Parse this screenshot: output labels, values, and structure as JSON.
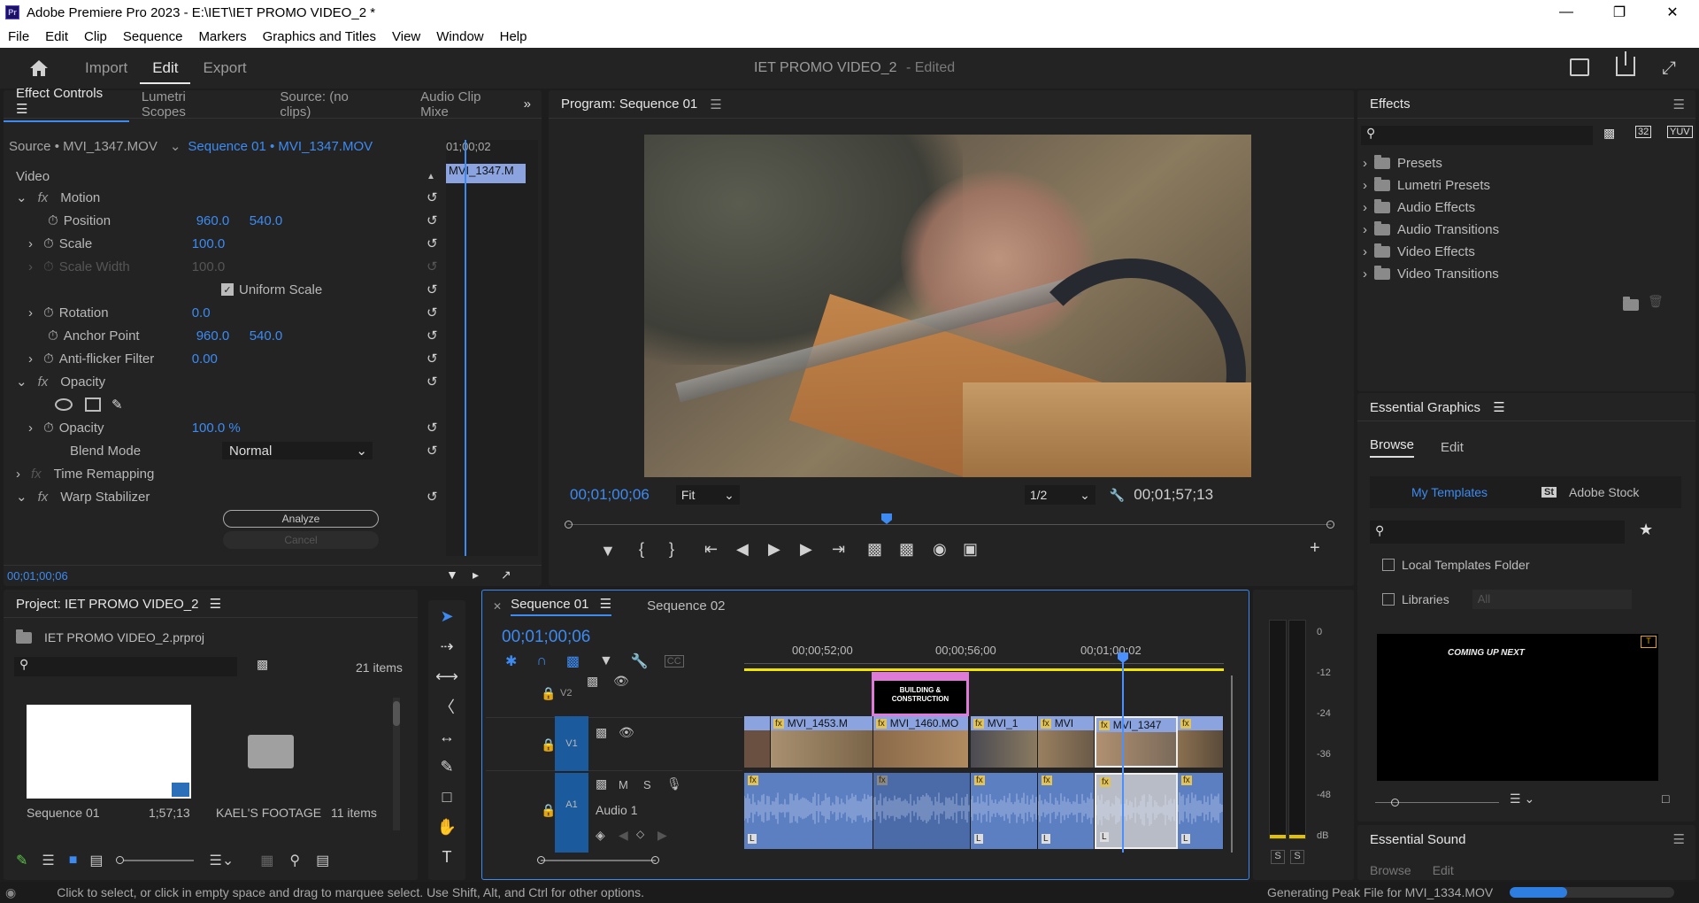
{
  "window": {
    "title": "Adobe Premiere Pro 2023 - E:\\IET\\IET PROMO VIDEO_2 *",
    "app_icon": "Pr",
    "controls": [
      "minimize",
      "maximize",
      "close"
    ]
  },
  "menu": [
    "File",
    "Edit",
    "Clip",
    "Sequence",
    "Markers",
    "Graphics and Titles",
    "View",
    "Window",
    "Help"
  ],
  "workspace": {
    "tabs": [
      "Import",
      "Edit",
      "Export"
    ],
    "active": "Edit",
    "project_title": "IET PROMO VIDEO_2",
    "project_status": "- Edited"
  },
  "effect_controls": {
    "tabs": [
      "Effect Controls",
      "Lumetri Scopes",
      "Source: (no clips)",
      "Audio Clip Mixe"
    ],
    "source": "Source • MVI_1347.MOV",
    "sequence": "Sequence 01 • MVI_1347.MOV",
    "mini_timecode": "01;00;02",
    "mini_clip": "MVI_1347.M",
    "section_video": "Video",
    "motion": "Motion",
    "position_label": "Position",
    "position_x": "960.0",
    "position_y": "540.0",
    "scale_label": "Scale",
    "scale": "100.0",
    "scale_width_label": "Scale Width",
    "scale_width": "100.0",
    "uniform_scale": "Uniform Scale",
    "rotation_label": "Rotation",
    "rotation": "0.0",
    "anchor_label": "Anchor Point",
    "anchor_x": "960.0",
    "anchor_y": "540.0",
    "antiflicker_label": "Anti-flicker Filter",
    "antiflicker": "0.00",
    "opacity": "Opacity",
    "opacity_label": "Opacity",
    "opacity_value": "100.0 %",
    "blend_label": "Blend Mode",
    "blend_value": "Normal",
    "time_remapping": "Time Remapping",
    "warp": "Warp Stabilizer",
    "analyze": "Analyze",
    "cancel": "Cancel",
    "timecode": "00;01;00;06"
  },
  "program": {
    "title": "Program: Sequence 01",
    "timecode": "00;01;00;06",
    "fit": "Fit",
    "resolution": "1/2",
    "duration": "00;01;57;13"
  },
  "effects": {
    "title": "Effects",
    "items": [
      "Presets",
      "Lumetri Presets",
      "Audio Effects",
      "Audio Transitions",
      "Video Effects",
      "Video Transitions"
    ]
  },
  "essential_graphics": {
    "title": "Essential Graphics",
    "tabs": [
      "Browse",
      "Edit"
    ],
    "my_templates": "My Templates",
    "adobe_stock": "Adobe Stock",
    "local_folder": "Local Templates Folder",
    "libraries": "Libraries",
    "libraries_value": "All",
    "thumb_text": "COMING UP NEXT"
  },
  "essential_sound": {
    "title": "Essential Sound",
    "tabs": [
      "Browse",
      "Edit"
    ]
  },
  "project": {
    "title": "Project: IET PROMO VIDEO_2",
    "file": "IET PROMO VIDEO_2.prproj",
    "count": "21 items",
    "items": [
      {
        "name": "Sequence 01",
        "meta": "1;57;13"
      },
      {
        "name": "KAEL'S FOOTAGE",
        "meta": "11 items"
      }
    ]
  },
  "timeline": {
    "tabs": [
      "Sequence 01",
      "Sequence 02"
    ],
    "timecode": "00;01;00;06",
    "ruler": [
      "00;00;52;00",
      "00;00;56;00",
      "00;01;00;02"
    ],
    "tracks": {
      "v2": "V2",
      "v1": "V1",
      "a1": "A1",
      "audio_name": "Audio 1"
    },
    "title_clip": "Building & Con",
    "title_card": "BUILDING & CONSTRUCTION",
    "video_clips": [
      "",
      "MVI_1453.M",
      "MVI_1460.MO",
      "MVI_1",
      "MVI",
      "MVI_1347",
      ""
    ],
    "m": "M",
    "s": "S"
  },
  "meters": {
    "labels": [
      "0",
      "-12",
      "-24",
      "-36",
      "-48",
      "dB"
    ],
    "solo": [
      "S",
      "S"
    ]
  },
  "status": {
    "hint": "Click to select, or click in empty space and drag to marquee select. Use Shift, Alt, and Ctrl for other options.",
    "progress_text": "Generating Peak File for MVI_1334.MOV",
    "progress": 0.35
  },
  "colors": {
    "accent": "#3d8bf2",
    "playhead": "#4a90ff",
    "clip_video": "#8ba4e0",
    "clip_audio": "#5c7fc2",
    "title_clip": "#e07ad8",
    "work_area": "#f2e600"
  }
}
